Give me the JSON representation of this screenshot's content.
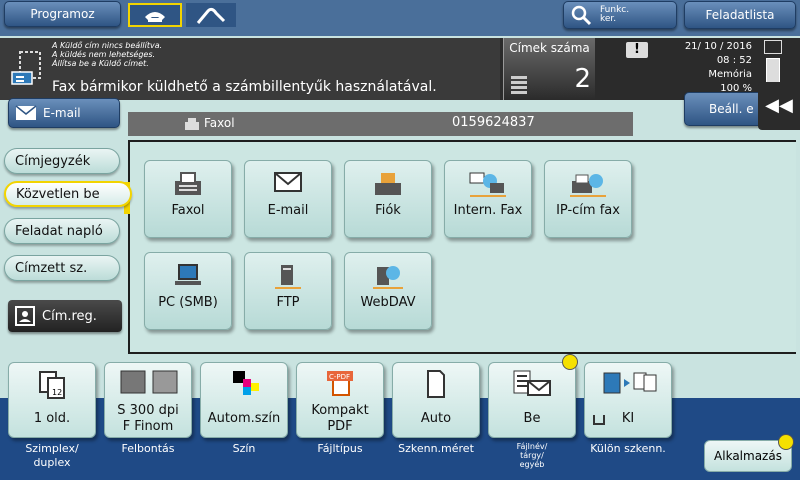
{
  "header": {
    "program_label": "Programoz",
    "func_label": "Funkc.\nker.",
    "joblist_label": "Feladatlista"
  },
  "message": {
    "line1": "A Küldő cím nincs beállítva.",
    "line2": "A küldés nem lehetséges.",
    "line3": "Állítsa be a Küldő címet.",
    "main": "Fax bármikor küldhető a számbillentyűk használatával."
  },
  "counter": {
    "label": "Címek száma",
    "value": "2"
  },
  "status": {
    "date": "21/ 10 / 2016",
    "time": "08 : 52",
    "memory_label": "Memória",
    "memory_value": "100 %"
  },
  "email_button": "E-mail",
  "settings_button": "Beáll. e",
  "address_bar": {
    "type": "Faxol",
    "number": "0159624837"
  },
  "sidebar": [
    {
      "label": "Címjegyzék"
    },
    {
      "label": "Közvetlen be"
    },
    {
      "label": "Feladat napló"
    },
    {
      "label": "Címzett sz."
    }
  ],
  "cimreg": "Cím.reg.",
  "destinations": [
    {
      "label": "Faxol",
      "icon": "fax-icon"
    },
    {
      "label": "E-mail",
      "icon": "email-icon"
    },
    {
      "label": "Fiók",
      "icon": "box-icon"
    },
    {
      "label": "Intern. Fax",
      "icon": "internet-fax-icon"
    },
    {
      "label": "IP-cím fax",
      "icon": "ip-fax-icon"
    },
    {
      "label": "PC (SMB)",
      "icon": "pc-icon"
    },
    {
      "label": "FTP",
      "icon": "ftp-icon"
    },
    {
      "label": "WebDAV",
      "icon": "webdav-icon"
    }
  ],
  "bottom": [
    {
      "value": "1 old.",
      "caption": "Szimplex/\nduplex"
    },
    {
      "value": "S 300 dpi\nF Finom",
      "caption": "Felbontás"
    },
    {
      "value": "Autom.szín",
      "caption": "Szín"
    },
    {
      "value": "Kompakt\nPDF",
      "caption": "Fájltípus",
      "icon_text": "C-PDF"
    },
    {
      "value": "Auto",
      "caption": "Szkenn.méret"
    },
    {
      "value": "Be",
      "caption": "Fájlnév/\ntárgy/\negyéb"
    },
    {
      "value": "KI",
      "caption": "Külön szkenn."
    }
  ],
  "apply_label": "Alkalmazás"
}
